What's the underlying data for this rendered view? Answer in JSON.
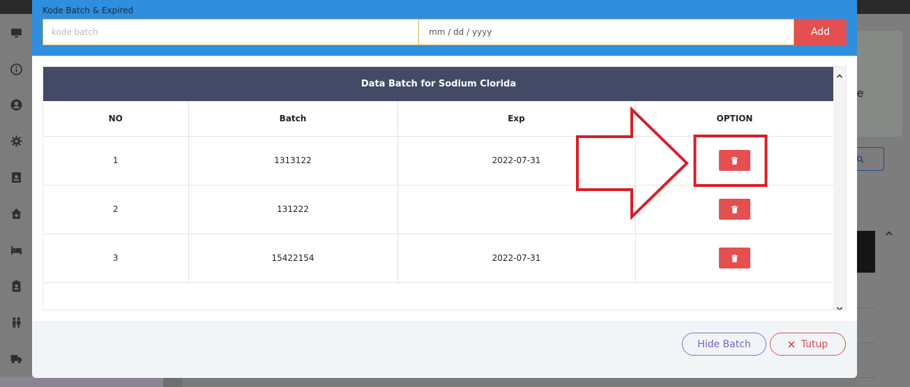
{
  "modal": {
    "batch_section_label": "Kode Batch & Expired",
    "batch_input_placeholder": "kode batch",
    "expired_input_value": "mm / dd / yyyy",
    "add_label": "Add",
    "table": {
      "caption": "Data Batch for Sodium Clorida",
      "headers": [
        "NO",
        "Batch",
        "Exp",
        "OPTION"
      ],
      "rows": [
        {
          "no": "1",
          "batch": "1313122",
          "exp": "2022-07-31"
        },
        {
          "no": "2",
          "batch": "131222",
          "exp": ""
        },
        {
          "no": "3",
          "batch": "15422154",
          "exp": "2022-07-31"
        }
      ]
    },
    "hide_batch_label": "Hide Batch",
    "close_label": "Tutup"
  },
  "background": {
    "card_text": "e"
  },
  "icons": {
    "sidebar": [
      "monitor-icon",
      "info-icon",
      "user-circle-icon",
      "gear-icon",
      "id-card-icon",
      "home-medical-icon",
      "bed-icon",
      "id-badge-icon",
      "people-icon",
      "truck-icon"
    ],
    "delete": "trash-icon",
    "close": "x-icon"
  },
  "colors": {
    "header_blue": "#2f8ede",
    "table_caption": "#424a66",
    "danger": "#e54f4f",
    "purple": "#7a5fcf",
    "annotation_red": "#d81f26"
  }
}
